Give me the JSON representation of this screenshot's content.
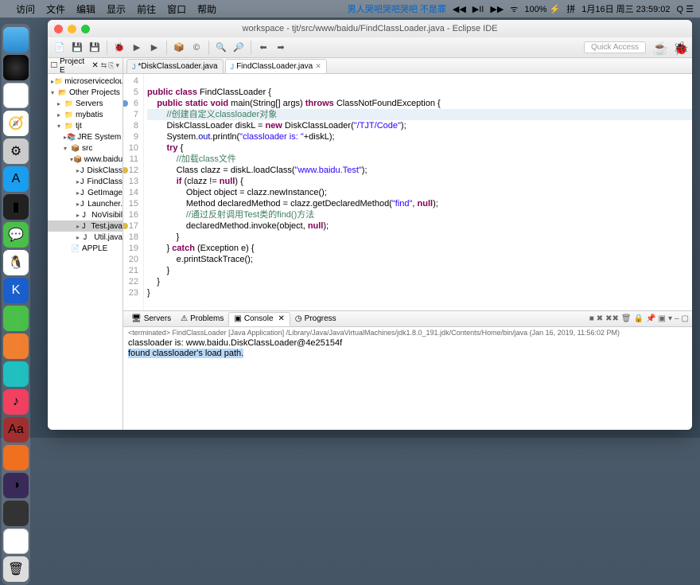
{
  "menubar": {
    "apple": "",
    "items": [
      "访问",
      "文件",
      "编辑",
      "显示",
      "前往",
      "窗口",
      "帮助"
    ],
    "status_blue": "男人哭吧哭吧哭吧 不是罪",
    "icons": [
      "◀◀",
      "▶II",
      "▶▶",
      "⇄",
      "◎",
      "≡",
      "⚡",
      "ᯤ",
      "100% ⚡",
      "⌨",
      "拼"
    ],
    "datetime": "1月16日 周三 23:59:02",
    "extra": "Q ☰"
  },
  "titlebar": {
    "title": "workspace - tjt/src/www/baidu/FindClassLoader.java - Eclipse IDE"
  },
  "toolbar": {
    "quick_access": "Quick Access"
  },
  "explorer": {
    "title": "Project E",
    "items": [
      {
        "t": "microservicecloud",
        "i": "▸",
        "ic": "📁",
        "d": 0
      },
      {
        "t": "Other Projects",
        "i": "▾",
        "ic": "📂",
        "d": 0
      },
      {
        "t": "Servers",
        "i": "▸",
        "ic": "📁",
        "d": 1
      },
      {
        "t": "mybatis",
        "i": "▸",
        "ic": "📁",
        "d": 1
      },
      {
        "t": "tjt",
        "i": "▾",
        "ic": "📁",
        "d": 1
      },
      {
        "t": "JRE System Lib",
        "i": "▸",
        "ic": "📚",
        "d": 2
      },
      {
        "t": "src",
        "i": "▾",
        "ic": "📦",
        "d": 2
      },
      {
        "t": "www.baidu",
        "i": "▾",
        "ic": "📦",
        "d": 3
      },
      {
        "t": "DiskClass",
        "i": "▸",
        "ic": "J",
        "d": 4
      },
      {
        "t": "FindClass",
        "i": "▸",
        "ic": "J",
        "d": 4
      },
      {
        "t": "GetImage",
        "i": "▸",
        "ic": "J",
        "d": 4
      },
      {
        "t": "Launcher.",
        "i": "▸",
        "ic": "J",
        "d": 4
      },
      {
        "t": "NoVisibil",
        "i": "▸",
        "ic": "J",
        "d": 4
      },
      {
        "t": "Test.java",
        "i": "▸",
        "ic": "J",
        "d": 4,
        "sel": true
      },
      {
        "t": "Util.java",
        "i": "▸",
        "ic": "J",
        "d": 4
      },
      {
        "t": "APPLE",
        "i": "",
        "ic": "📄",
        "d": 2
      }
    ]
  },
  "editor": {
    "tabs": [
      {
        "label": "*DiskClassLoader.java",
        "active": false
      },
      {
        "label": "FindClassLoader.java",
        "active": true
      }
    ],
    "lines": [
      {
        "n": 4,
        "h": ""
      },
      {
        "n": 5,
        "h": "<span class='kw'>public</span> <span class='kw'>class</span> FindClassLoader {"
      },
      {
        "n": 6,
        "h": "    <span class='kw'>public</span> <span class='kw'>static</span> <span class='kw'>void</span> main(String[] args) <span class='kw'>throws</span> ClassNotFoundException {",
        "m": "blue"
      },
      {
        "n": 7,
        "h": "        <span class='com'>//创建自定义classloader对象</span>",
        "hl": true
      },
      {
        "n": 8,
        "h": "        DiskClassLoader diskL = <span class='kw'>new</span> DiskClassLoader(<span class='str'>\"/TJT/Code\"</span>);"
      },
      {
        "n": 9,
        "h": "        System.<span class='fld'>out</span>.println(<span class='str'>\"classloader is: \"</span>+diskL);"
      },
      {
        "n": 10,
        "h": "        <span class='kw'>try</span> {"
      },
      {
        "n": 11,
        "h": "            <span class='com'>//加载class文件</span>"
      },
      {
        "n": 12,
        "h": "            Class clazz = diskL.loadClass(<span class='str'>\"www.baidu.Test\"</span>);",
        "m": "yellow"
      },
      {
        "n": 13,
        "h": "            <span class='kw'>if</span> (clazz != <span class='kw'>null</span>) {"
      },
      {
        "n": 14,
        "h": "                Object object = clazz.newInstance();"
      },
      {
        "n": 15,
        "h": "                Method declaredMethod = clazz.getDeclaredMethod(<span class='str'>\"find\"</span>, <span class='kw'>null</span>);"
      },
      {
        "n": 16,
        "h": "                <span class='com'>//通过反射调用Test类的find()方法</span>"
      },
      {
        "n": 17,
        "h": "                <span class='mth'>declaredMethod</span>.invoke(<span class='mth'>object</span>, <span class='kw'>null</span>);",
        "m": "yellow"
      },
      {
        "n": 18,
        "h": "            }"
      },
      {
        "n": 19,
        "h": "        } <span class='kw'>catch</span> (Exception e) {"
      },
      {
        "n": 20,
        "h": "            e.printStackTrace();"
      },
      {
        "n": 21,
        "h": "        }"
      },
      {
        "n": 22,
        "h": "    }"
      },
      {
        "n": 23,
        "h": "}"
      }
    ]
  },
  "console": {
    "tabs": [
      "Servers",
      "Problems",
      "Console",
      "Progress"
    ],
    "active_tab": 2,
    "header": "<terminated> FindClassLoader [Java Application] /Library/Java/JavaVirtualMachines/jdk1.8.0_191.jdk/Contents/Home/bin/java (Jan 16, 2019, 11:56:02 PM)",
    "lines": [
      {
        "t": "classloader is: www.baidu.DiskClassLoader@4e25154f",
        "sel": false
      },
      {
        "t": "found classloader's load path.",
        "sel": true
      }
    ]
  }
}
